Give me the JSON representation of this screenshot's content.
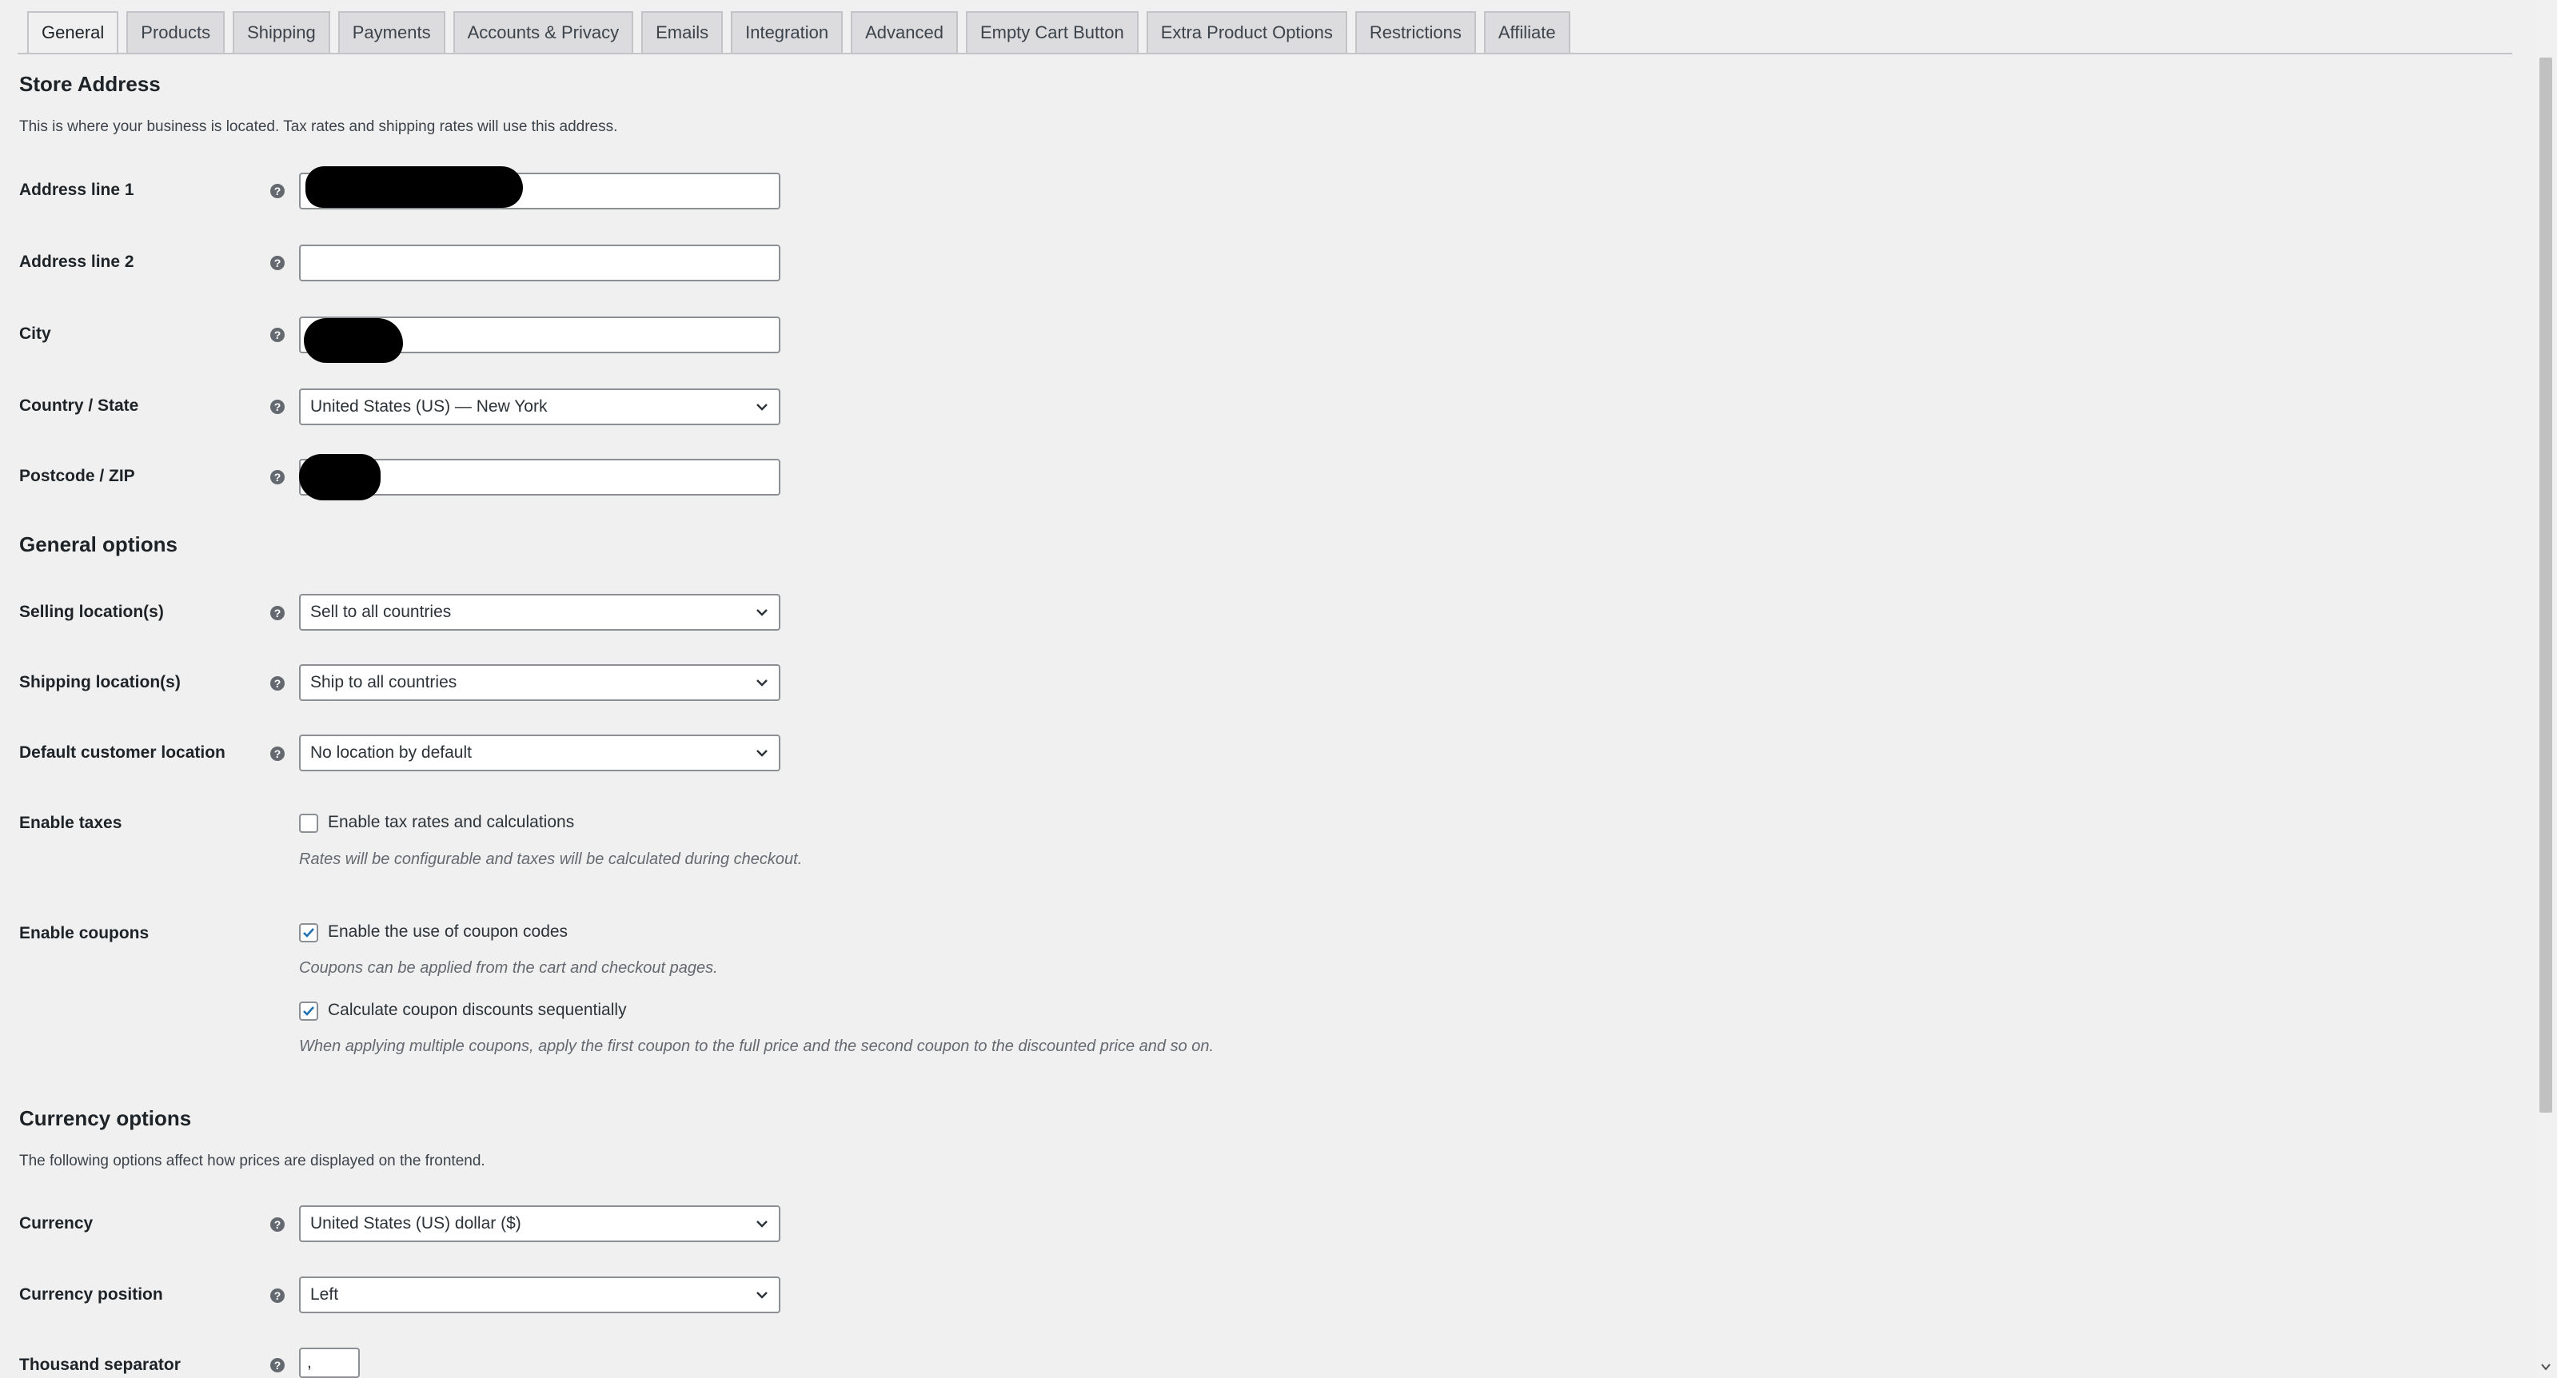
{
  "tabs": [
    {
      "label": "General",
      "active": true
    },
    {
      "label": "Products"
    },
    {
      "label": "Shipping"
    },
    {
      "label": "Payments"
    },
    {
      "label": "Accounts & Privacy"
    },
    {
      "label": "Emails"
    },
    {
      "label": "Integration"
    },
    {
      "label": "Advanced"
    },
    {
      "label": "Empty Cart Button"
    },
    {
      "label": "Extra Product Options"
    },
    {
      "label": "Restrictions"
    },
    {
      "label": "Affiliate"
    }
  ],
  "store_address": {
    "title": "Store Address",
    "description": "This is where your business is located. Tax rates and shipping rates will use this address.",
    "address1": {
      "label": "Address line 1",
      "value": ""
    },
    "address2": {
      "label": "Address line 2",
      "value": ""
    },
    "city": {
      "label": "City",
      "value": ""
    },
    "country": {
      "label": "Country / State",
      "value": "United States (US) — New York"
    },
    "postcode": {
      "label": "Postcode / ZIP",
      "value": ""
    }
  },
  "general_options": {
    "title": "General options",
    "selling": {
      "label": "Selling location(s)",
      "value": "Sell to all countries"
    },
    "shipping": {
      "label": "Shipping location(s)",
      "value": "Ship to all countries"
    },
    "default_location": {
      "label": "Default customer location",
      "value": "No location by default"
    },
    "taxes": {
      "label": "Enable taxes",
      "checkbox_label": "Enable tax rates and calculations",
      "checked": false,
      "hint": "Rates will be configurable and taxes will be calculated during checkout."
    },
    "coupons": {
      "label": "Enable coupons",
      "use_label": "Enable the use of coupon codes",
      "use_checked": true,
      "use_hint": "Coupons can be applied from the cart and checkout pages.",
      "seq_label": "Calculate coupon discounts sequentially",
      "seq_checked": true,
      "seq_hint": "When applying multiple coupons, apply the first coupon to the full price and the second coupon to the discounted price and so on."
    }
  },
  "currency_options": {
    "title": "Currency options",
    "description": "The following options affect how prices are displayed on the frontend.",
    "currency": {
      "label": "Currency",
      "value": "United States (US) dollar ($)"
    },
    "position": {
      "label": "Currency position",
      "value": "Left"
    },
    "thousand": {
      "label": "Thousand separator",
      "value": ","
    }
  },
  "help_glyph": "?",
  "icons": {
    "help": "help-circle-icon",
    "select": "chevron-down-icon",
    "check": "checkmark-icon"
  },
  "colors": {
    "accent": "#2271b1",
    "background": "#f0f0f1",
    "border": "#8c8f94",
    "tab_bg": "#dcdcde"
  }
}
